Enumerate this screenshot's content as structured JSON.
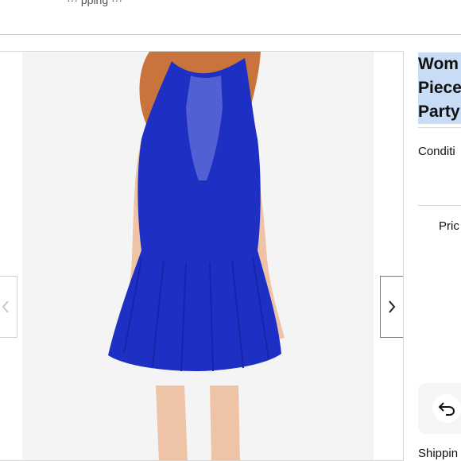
{
  "header": {
    "cut_text": "··· pping ··· "
  },
  "gallery": {
    "image_alt": "Blue sleeveless flared dress with sheer mesh inset worn by model",
    "prev_icon": "chevron-left-icon",
    "next_icon": "chevron-right-icon"
  },
  "listing": {
    "title_lines": [
      "Wom",
      "Piece",
      "Party"
    ],
    "condition_label": "Conditi",
    "price_label": "Pric",
    "return_icon": "undo-arrow-icon",
    "shipping_label": "Shippin"
  },
  "colors": {
    "dress_blue": "#1e2fc4",
    "title_highlight": "#c9dcf5",
    "photo_background": "#f4f4f4"
  }
}
